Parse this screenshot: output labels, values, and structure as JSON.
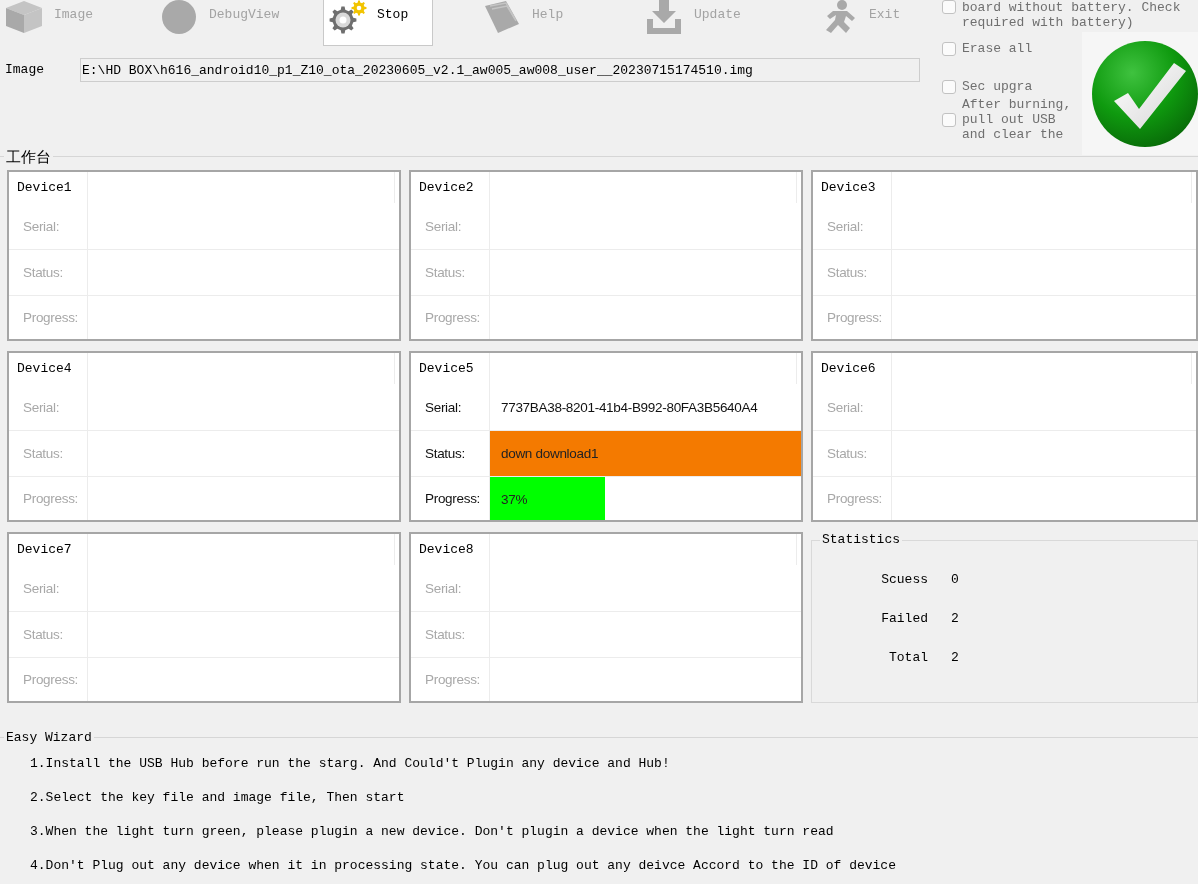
{
  "toolbar": [
    {
      "label": "Image",
      "disabled": true,
      "selected": false
    },
    {
      "label": "DebugView",
      "disabled": true,
      "selected": false
    },
    {
      "label": "Stop",
      "disabled": false,
      "selected": true
    },
    {
      "label": "Help",
      "disabled": true,
      "selected": false
    },
    {
      "label": "Update",
      "disabled": true,
      "selected": false
    },
    {
      "label": "Exit",
      "disabled": true,
      "selected": false
    }
  ],
  "image_file": {
    "label": "Image",
    "value": "E:\\HD BOX\\h616_android10_p1_Z10_ota_20230605_v2.1_aw005_aw008_user__20230715174510.img"
  },
  "options": [
    {
      "label": "board without battery. Check required with battery)",
      "checked": false,
      "disabled": true
    },
    {
      "label": "Erase all",
      "checked": false,
      "disabled": true
    },
    {
      "label": "Sec upgra",
      "checked": false,
      "disabled": true
    },
    {
      "label": "After burning, pull out USB and clear the",
      "checked": false,
      "disabled": true
    }
  ],
  "workbench": {
    "title": "工作台",
    "devices": [
      {
        "name": "Device1",
        "disabled": true,
        "rows": [
          {
            "kind": "text",
            "label": "Serial:"
          },
          {
            "kind": "status",
            "label": "Status:"
          },
          {
            "kind": "progress",
            "label": "Progress:"
          }
        ]
      },
      {
        "name": "Device2",
        "disabled": true,
        "rows": [
          {
            "kind": "text",
            "label": "Serial:"
          },
          {
            "kind": "status",
            "label": "Status:"
          },
          {
            "kind": "progress",
            "label": "Progress:"
          }
        ]
      },
      {
        "name": "Device3",
        "disabled": true,
        "rows": [
          {
            "kind": "text",
            "label": "Serial:"
          },
          {
            "kind": "status",
            "label": "Status:"
          },
          {
            "kind": "progress",
            "label": "Progress:"
          }
        ]
      },
      {
        "name": "Device4",
        "disabled": true,
        "rows": [
          {
            "kind": "text",
            "label": "Serial:"
          },
          {
            "kind": "status",
            "label": "Status:"
          },
          {
            "kind": "progress",
            "label": "Progress:"
          }
        ]
      },
      {
        "name": "Device5",
        "disabled": false,
        "rows": [
          {
            "kind": "text",
            "label": "Serial:",
            "value": "7737BA38-8201-41b4-B992-80FA3B5640A4"
          },
          {
            "kind": "status",
            "label": "Status:",
            "value": "down download1",
            "color": "#f47a00"
          },
          {
            "kind": "progress",
            "label": "Progress:",
            "value": "37%",
            "level": 0.37
          }
        ]
      },
      {
        "name": "Device6",
        "disabled": true,
        "rows": [
          {
            "kind": "text",
            "label": "Serial:"
          },
          {
            "kind": "status",
            "label": "Status:"
          },
          {
            "kind": "progress",
            "label": "Progress:"
          }
        ]
      },
      {
        "name": "Device7",
        "disabled": true,
        "rows": [
          {
            "kind": "text",
            "label": "Serial:"
          },
          {
            "kind": "status",
            "label": "Status:"
          },
          {
            "kind": "progress",
            "label": "Progress:"
          }
        ]
      },
      {
        "name": "Device8",
        "disabled": true,
        "rows": [
          {
            "kind": "text",
            "label": "Serial:"
          },
          {
            "kind": "status",
            "label": "Status:"
          },
          {
            "kind": "progress",
            "label": "Progress:"
          }
        ]
      }
    ]
  },
  "statistics": {
    "title": "Statistics",
    "rows": [
      {
        "label": "Scuess",
        "value": "0"
      },
      {
        "label": "Failed",
        "value": "2"
      },
      {
        "label": "Total",
        "value": "2"
      }
    ]
  },
  "wizard": {
    "title": "Easy Wizard",
    "steps": [
      "1.Install the USB Hub before run the starg. And Could't Plugin any device and Hub!",
      "2.Select the key file and image file, Then start",
      "3.When the light turn green, please plugin a new device. Don't plugin a device when the light turn read",
      "4.Don't Plug out any device when it in processing state. You can plug out any deivce Accord to the ID of device"
    ]
  }
}
